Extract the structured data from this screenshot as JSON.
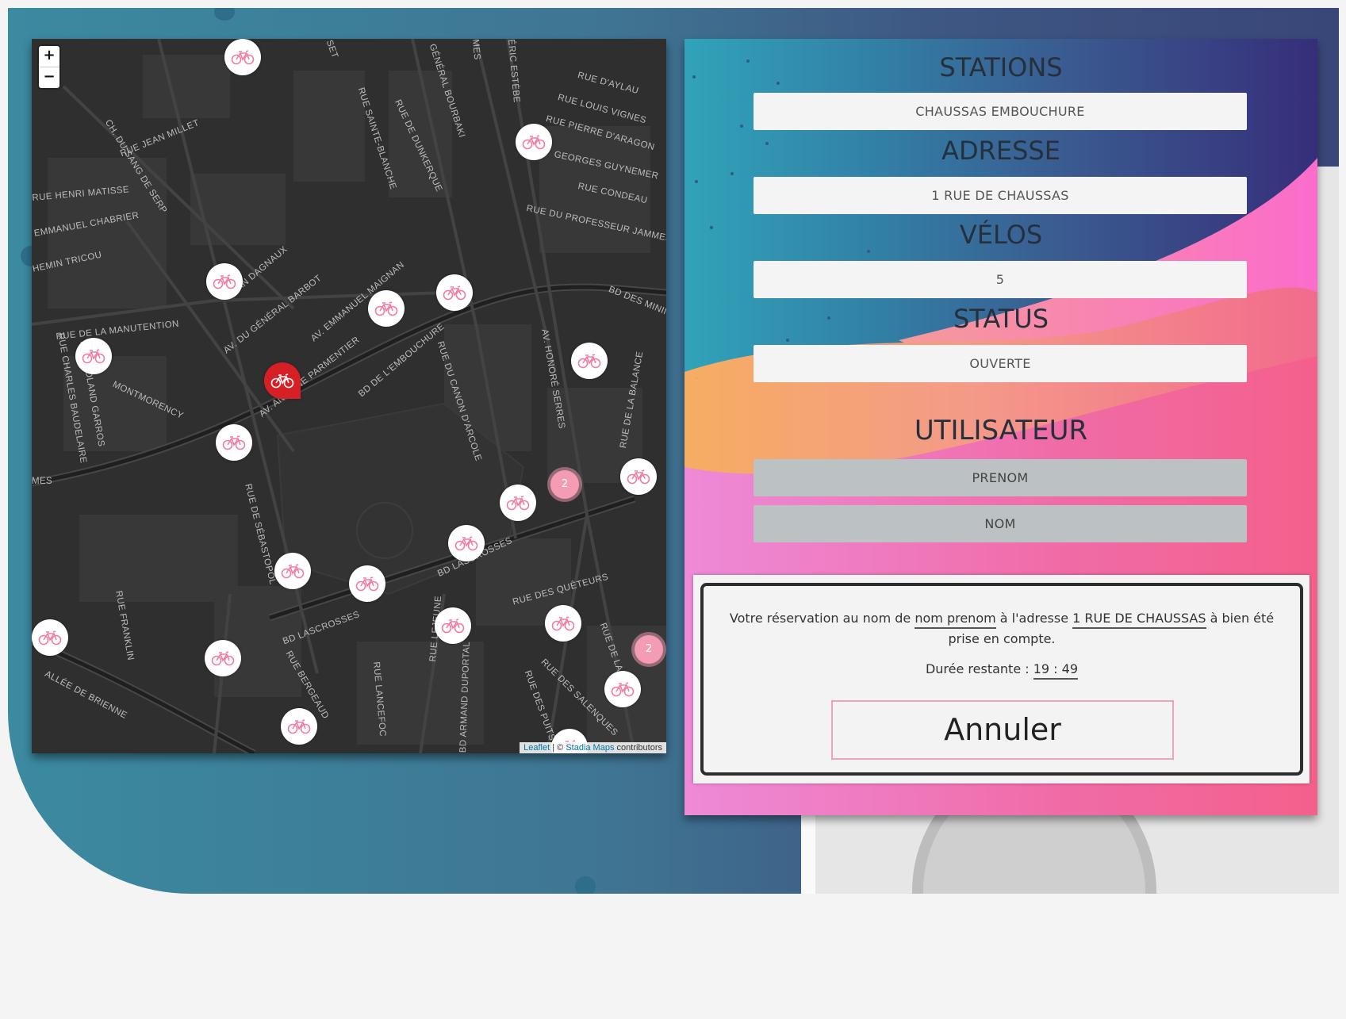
{
  "map": {
    "zoom_in": "+",
    "zoom_out": "−",
    "attribution_leaflet": "Leaflet",
    "attribution_sep": " | © ",
    "attribution_stadia": "Stadia Maps",
    "attribution_tail": " contributors",
    "streets": [
      "RUE JEAN MILLET",
      "CH. DU SANG DE SERP",
      "RUE HENRI MATISSE",
      "EMMANUEL CHABRIER",
      "HEMIN TRICOU",
      "RUE DE LA MANUTENTION",
      "AV. DU GÉNÉRAL BARBOT",
      "JEAN DAGNAUX",
      "AV. EMMANUEL MAIGNAN",
      "AV. ANTOINE PARMENTIER",
      "BD DE L'EMBOUCHURE",
      "BD DES MINIMES",
      "RUE SAINTE-BLANCHE",
      "RUE DE DUNKERQUE",
      "GÉNÉRAL BOURBAKI",
      "RUE D'AYLAU",
      "RUE LOUIS VIGNES",
      "RUE PIERRE D'ARAGON",
      "GEORGES GUYNEMER",
      "RUE CONDEAU",
      "RUE DU PROFESSEUR JAMMES",
      "AV. HONORÉ SERRES",
      "RUE DU CANON D'ARCOLE",
      "RUE DE LA BALANCE",
      "RUE ROLAND GARROS",
      "MONTMORENCY",
      "RUE CHARLES BAUDELAIRE",
      "RUE DE SÉBASTOPOL",
      "BD LASCROSSES",
      "RUE DES QUÊTEURS",
      "RUE DES SALENQUES",
      "RUE DES PUITS CREUSÉS",
      "RUE FRANKLIN",
      "ALLÉE DE BRIENNE",
      "RUE BERGEAUD",
      "RUE LANCEFOC",
      "RUE LEJEUNE",
      "BD ARMAND DUPORTAL",
      "RUE DE LA",
      "BD LASCROSSES",
      "SET",
      "ÉRIC ESTÈBE",
      "MES",
      "MES"
    ],
    "clusters": [
      "2",
      "2"
    ],
    "bike_icon": "bicycle-icon",
    "selected_color": "#d71f26",
    "cluster_color": "#f49cb4"
  },
  "panel": {
    "stations_title": "STATIONS",
    "station_value": "CHAUSSAS EMBOUCHURE",
    "adresse_title": "ADRESSE",
    "adresse_value": "1 RUE DE CHAUSSAS",
    "velos_title": "VÉLOS",
    "velos_value": "5",
    "status_title": "STATUS",
    "status_value": "OUVERTE",
    "utilisateur_title": "UTILISATEUR",
    "prenom_placeholder": "PRENOM",
    "nom_placeholder": "NOM"
  },
  "reservation": {
    "text_1": "Votre réservation au nom de ",
    "user_name": "nom prenom",
    "text_2": " à l'adresse ",
    "address": "1 RUE DE CHAUSSAS",
    "text_3": " à bien été prise en compte.",
    "timer_label": "Durée restante : ",
    "minutes": "19",
    "timer_sep": " : ",
    "seconds": "49",
    "cancel_label": "Annuler"
  }
}
